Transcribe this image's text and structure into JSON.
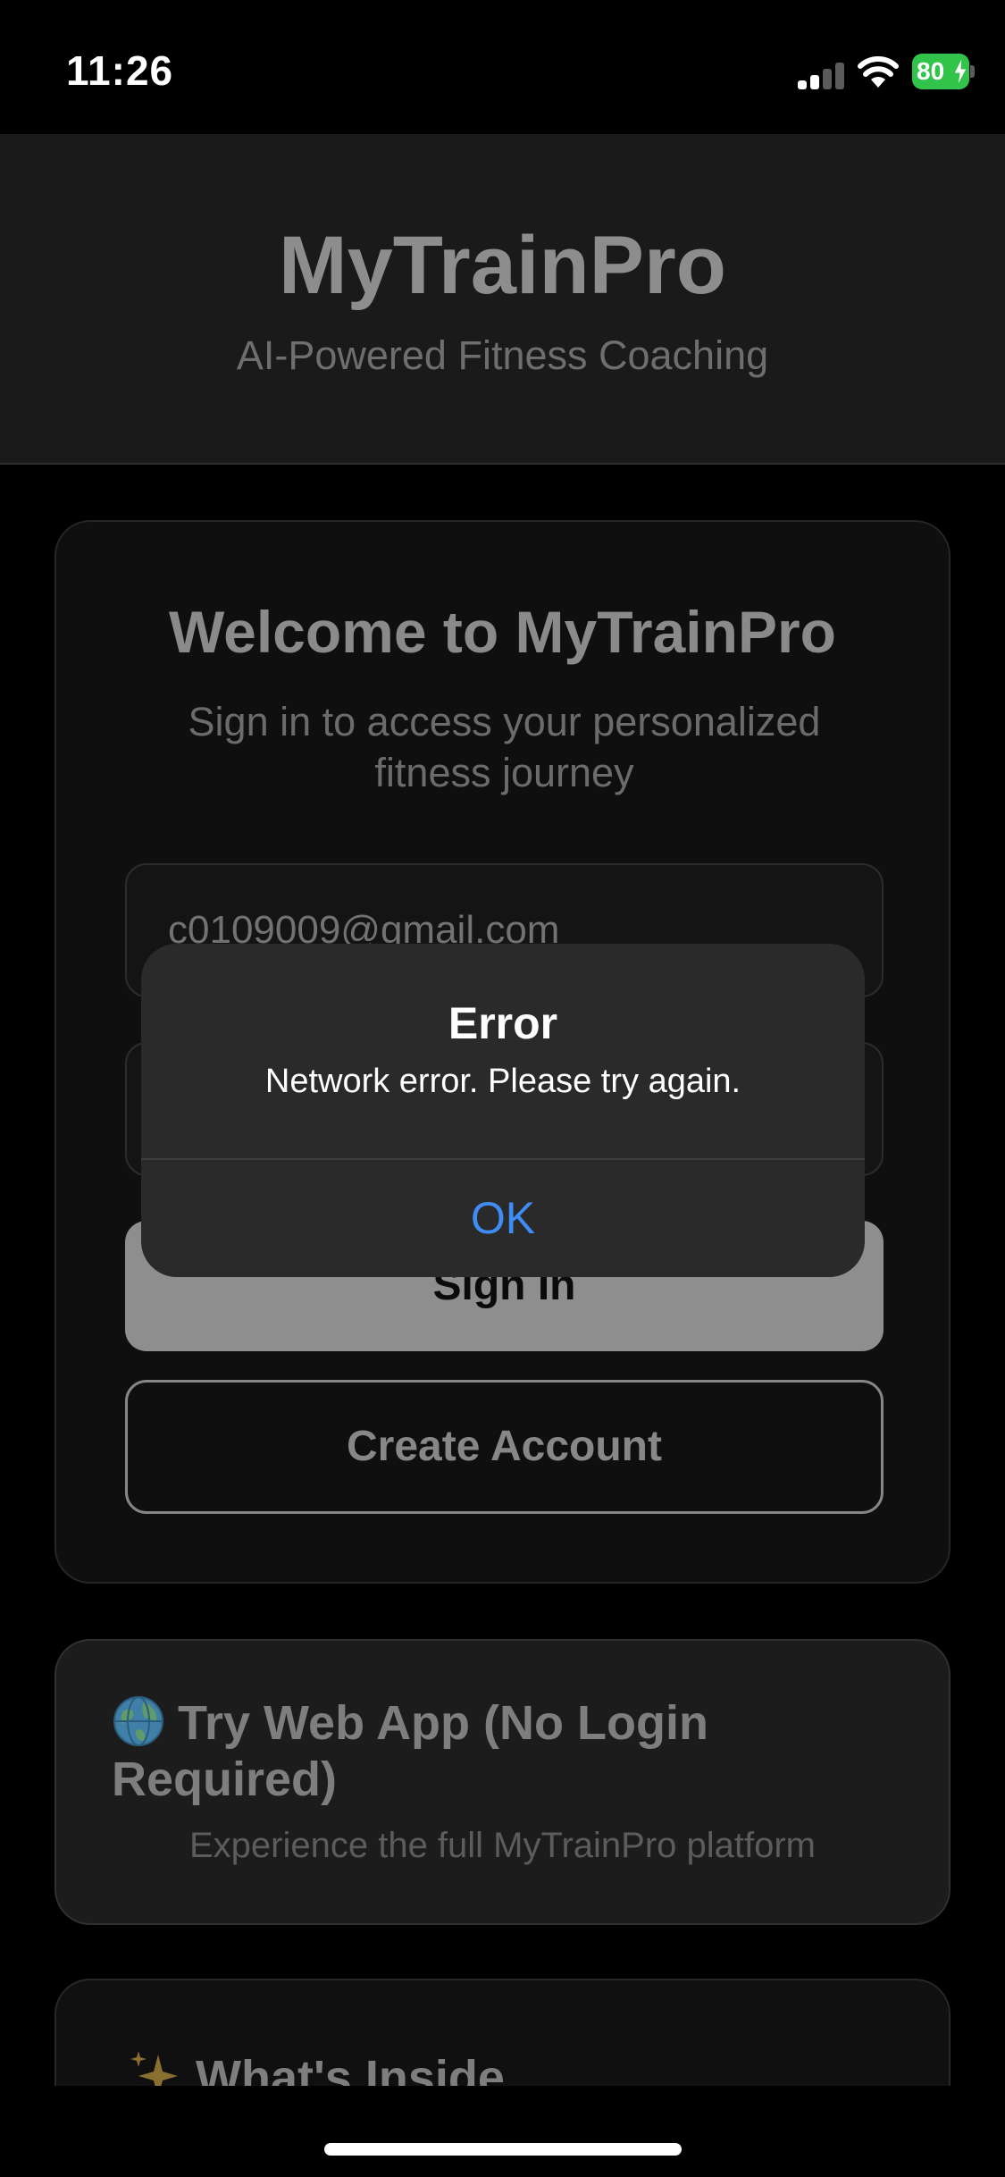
{
  "status_bar": {
    "time": "11:26",
    "battery": "80",
    "battery_color": "#32c44a"
  },
  "header": {
    "title": "MyTrainPro",
    "subtitle": "AI-Powered Fitness Coaching"
  },
  "login": {
    "title": "Welcome to MyTrainPro",
    "subtitle": "Sign in to access your personalized fitness journey",
    "email_value": "c0109009@gmail.com",
    "signin_label": "Sign In",
    "create_label": "Create Account"
  },
  "web_app": {
    "title": "Try Web App (No Login Required)",
    "description": "Experience the full MyTrainPro platform",
    "icon": "globe-icon"
  },
  "inside": {
    "title": "What's Inside",
    "icon": "sparkles-icon"
  },
  "alert": {
    "title": "Error",
    "message": "Network error. Please try again.",
    "ok_label": "OK",
    "ok_color": "#3f8cf5"
  }
}
